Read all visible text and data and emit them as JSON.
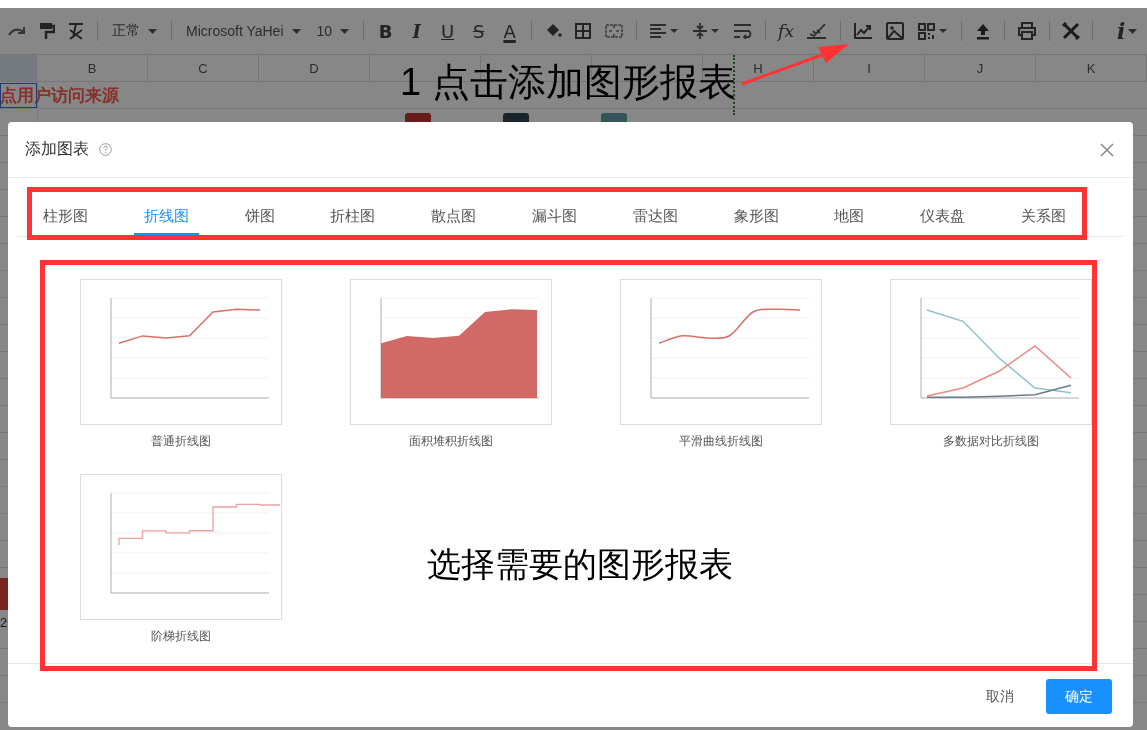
{
  "toolbar": {
    "style_select": "正常",
    "font_select": "Microsoft YaHei",
    "size_select": "10",
    "format_buttons": [
      {
        "kind": "bold",
        "label": "B"
      },
      {
        "kind": "italic",
        "label": "I"
      },
      {
        "kind": "underline",
        "label": "U"
      },
      {
        "kind": "strike",
        "label": "S"
      },
      {
        "kind": "color",
        "label": "A"
      }
    ],
    "function_button": "fx",
    "info_button": "i"
  },
  "sheet": {
    "columns_left": [
      "B",
      "C",
      "D"
    ],
    "columns_right": [
      "H",
      "I",
      "J",
      "K"
    ],
    "title_cell": "点用户访问来源",
    "cell_fragment": "2"
  },
  "annotations": {
    "step_1": "1 点击添加图形报表",
    "step_2": "选择需要的图形报表"
  },
  "dialog": {
    "title": "添加图表",
    "tabs": [
      {
        "label": "柱形图",
        "selected": false
      },
      {
        "label": "折线图",
        "selected": true
      },
      {
        "label": "饼图",
        "selected": false
      },
      {
        "label": "折柱图",
        "selected": false
      },
      {
        "label": "散点图",
        "selected": false
      },
      {
        "label": "漏斗图",
        "selected": false
      },
      {
        "label": "雷达图",
        "selected": false
      },
      {
        "label": "象形图",
        "selected": false
      },
      {
        "label": "地图",
        "selected": false
      },
      {
        "label": "仪表盘",
        "selected": false
      },
      {
        "label": "关系图",
        "selected": false
      }
    ],
    "charts": [
      {
        "kind": "line",
        "label": "普通折线图"
      },
      {
        "kind": "area",
        "label": "面积堆积折线图"
      },
      {
        "kind": "smooth",
        "label": "平滑曲线折线图"
      },
      {
        "kind": "multi",
        "label": "多数据对比折线图"
      },
      {
        "kind": "step",
        "label": "阶梯折线图"
      }
    ],
    "buttons": {
      "cancel": "取消",
      "confirm": "确定"
    }
  }
}
